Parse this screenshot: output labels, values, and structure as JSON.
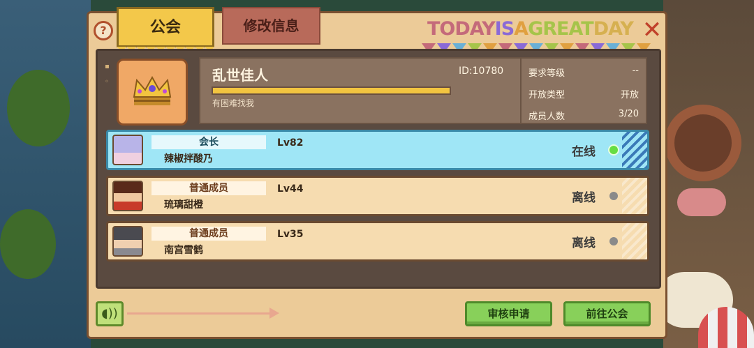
{
  "tabs": {
    "guild": "公会",
    "edit": "修改信息"
  },
  "banner": {
    "segments": [
      {
        "text": "TODAY ",
        "color": "#c46a7a"
      },
      {
        "text": "IS ",
        "color": "#8a6ad6"
      },
      {
        "text": "A ",
        "color": "#e0a040"
      },
      {
        "text": "GREAT ",
        "color": "#a6c44a"
      },
      {
        "text": "DAY",
        "color": "#d6b050"
      }
    ]
  },
  "guild": {
    "name": "乱世佳人",
    "id": "ID:10780",
    "motto": "有困难找我",
    "xp_progress": 1.0
  },
  "stats": [
    {
      "label": "要求等级",
      "value": "--"
    },
    {
      "label": "开放类型",
      "value": "开放"
    },
    {
      "label": "成员人数",
      "value": "3/20"
    }
  ],
  "members": [
    {
      "role": "会长",
      "name": "辣椒拌酸乃",
      "level": "Lv82",
      "status": "在线",
      "online": true
    },
    {
      "role": "普通成员",
      "name": "琉璃甜橙",
      "level": "Lv44",
      "status": "离线",
      "online": false
    },
    {
      "role": "普通成员",
      "name": "南宫雪鹤",
      "level": "Lv35",
      "status": "离线",
      "online": false
    }
  ],
  "buttons": {
    "review": "审核申请",
    "goto_guild": "前往公会"
  },
  "icons": {
    "help": "question-icon",
    "close": "close-icon",
    "voice": "speaker-icon",
    "crest": "crown-icon"
  },
  "colors": {
    "accent": "#f3c84a",
    "online": "#66dd44",
    "offline": "#8a8a8a",
    "leader_row": "#9fe6f6"
  }
}
